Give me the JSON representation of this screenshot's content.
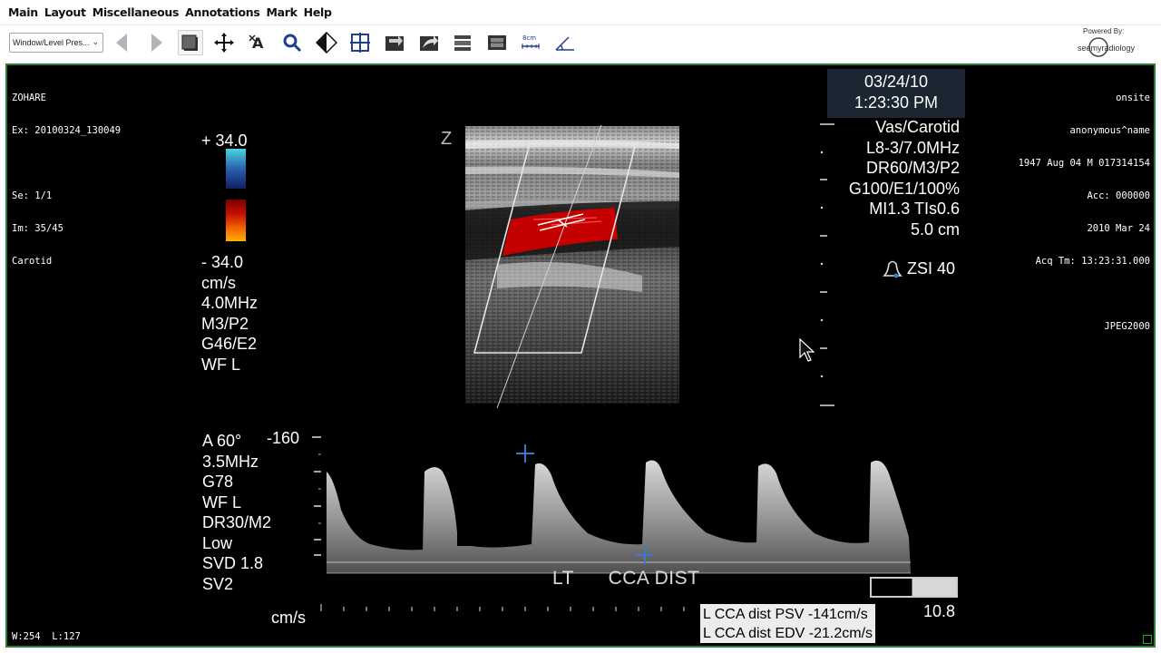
{
  "menu": [
    "Main",
    "Layout",
    "Miscellaneous",
    "Annotations",
    "Mark",
    "Help"
  ],
  "toolbar": {
    "window_level_preset": "Window/Level Pres...",
    "tools": [
      "prev-arrow-icon",
      "next-arrow-icon",
      "stack-icon",
      "pan-move-icon",
      "text-annotate-icon",
      "zoom-magnifier-icon",
      "window-level-contrast-icon",
      "crosshair-grid-icon",
      "rotate-icon",
      "flip-icon",
      "series-stack-icon",
      "film-strip-icon",
      "ruler-measure-icon",
      "angle-measure-icon"
    ],
    "ruler_label": "8cm",
    "powered_by": "Powered By:",
    "logo_text": "seemyradiology"
  },
  "overlay": {
    "top_left": [
      "ZOHARE",
      "Ex: 20100324_130049",
      "",
      "Se: 1/1",
      "Im: 35/45",
      "Carotid"
    ],
    "top_right": [
      "onsite",
      "anonymous^name",
      "1947 Aug 04 M 017314154",
      "Acc: 000000",
      "2010 Mar 24",
      "Acq Tm: 13:23:31.000",
      "",
      "JPEG2000"
    ],
    "bottom_left": "W:254  L:127"
  },
  "cdi": {
    "pos_scale": "+ 34.0",
    "neg_scale": "- 34.0",
    "params": [
      "cm/s",
      "4.0MHz",
      "M3/P2",
      "G46/E2",
      "WF L"
    ]
  },
  "datetime": {
    "date": "03/24/10",
    "time": "1:23:30 PM"
  },
  "scan_params": [
    "Vas/Carotid",
    "L8-3/7.0MHz",
    "DR60/M3/P2",
    "G100/E1/100%",
    "MI1.3  TIs0.6",
    "5.0 cm"
  ],
  "zsi": "ZSI 40",
  "doppler": {
    "params": [
      "A 60°",
      "3.5MHz",
      "G78",
      "WF L",
      "DR30/M2",
      "Low",
      "SVD 1.8",
      "SV2"
    ],
    "vel_top": "-160",
    "units": "cm/s",
    "annotation": "LT      CCA DIST"
  },
  "measurements": [
    "L CCA dist PSV -141cm/s",
    "L CCA dist EDV -21.2cm/s"
  ],
  "gray_value": "10.8",
  "colors": {
    "flow_red": "#c40000",
    "viewer_border": "#2e7d32",
    "datetime_bg": "#1b2632"
  }
}
